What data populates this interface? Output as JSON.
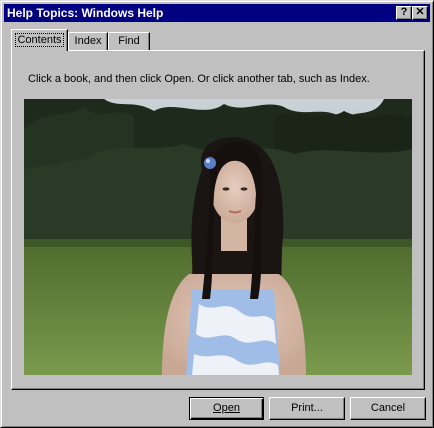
{
  "window": {
    "title": "Help Topics: Windows Help",
    "help_glyph": "?",
    "close_glyph": "✕"
  },
  "tabs": [
    {
      "label": "Contents",
      "active": true
    },
    {
      "label": "Index",
      "active": false
    },
    {
      "label": "Find",
      "active": false
    }
  ],
  "panel": {
    "instructions": "Click a book, and then click Open. Or click another tab, such as Index.",
    "image": {
      "description_icon": "photo-image",
      "dominant_colors": [
        "#1f2a1c",
        "#3f5a2c",
        "#6f8a45",
        "#9fb9e0",
        "#d9c2b2"
      ]
    }
  },
  "buttons": {
    "open": "Open",
    "print": "Print...",
    "cancel": "Cancel"
  },
  "colors": {
    "titlebar": "#000080",
    "face": "#c0c0c0"
  }
}
